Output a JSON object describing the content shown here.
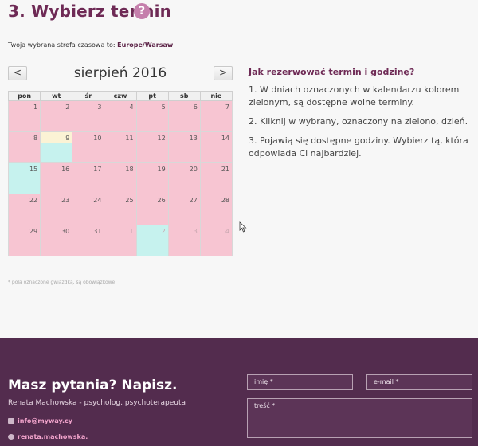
{
  "header": {
    "title": "3. Wybierz termin",
    "help_icon": "?"
  },
  "timezone": {
    "prefix": "Twoja wybrana strefa czasowa to:",
    "value": "Europe/Warsaw"
  },
  "calendar": {
    "prev_label": "<",
    "next_label": ">",
    "month_title": "sierpień 2016",
    "weekdays": [
      "pon",
      "wt",
      "śr",
      "czw",
      "pt",
      "sb",
      "nie"
    ],
    "weeks": [
      [
        {
          "d": "1"
        },
        {
          "d": "2"
        },
        {
          "d": "3"
        },
        {
          "d": "4"
        },
        {
          "d": "5"
        },
        {
          "d": "6"
        },
        {
          "d": "7"
        }
      ],
      [
        {
          "d": "8"
        },
        {
          "d": "9",
          "state": "today"
        },
        {
          "d": "10"
        },
        {
          "d": "11"
        },
        {
          "d": "12"
        },
        {
          "d": "13"
        },
        {
          "d": "14"
        }
      ],
      [
        {
          "d": "15",
          "state": "green"
        },
        {
          "d": "16"
        },
        {
          "d": "17"
        },
        {
          "d": "18"
        },
        {
          "d": "19"
        },
        {
          "d": "20"
        },
        {
          "d": "21"
        }
      ],
      [
        {
          "d": "22"
        },
        {
          "d": "23"
        },
        {
          "d": "24"
        },
        {
          "d": "25"
        },
        {
          "d": "26"
        },
        {
          "d": "27"
        },
        {
          "d": "28"
        }
      ],
      [
        {
          "d": "29"
        },
        {
          "d": "30"
        },
        {
          "d": "31"
        },
        {
          "d": "1",
          "state": "other"
        },
        {
          "d": "2",
          "state": "other-green"
        },
        {
          "d": "3",
          "state": "other"
        },
        {
          "d": "4",
          "state": "other"
        }
      ]
    ]
  },
  "instructions": {
    "title": "Jak rezerwować termin i godzinę?",
    "steps": [
      "1. W dniach oznaczonych w kalendarzu kolorem zielonym, są dostępne wolne terminy.",
      "2. Kliknij w wybrany, oznaczony na zielono, dzień.",
      "3. Pojawią się dostępne godziny. Wybierz tą, która odpowiada Ci najbardziej."
    ]
  },
  "required_note": "* pola oznaczone gwiazdką, są obowiązkowe",
  "footer": {
    "title": "Masz pytania? Napisz.",
    "subtitle": "Renata Machowska - psycholog, psychoterapeuta",
    "email": "info@myway.cy",
    "skype": "renata.machowska.",
    "name_placeholder": "imię *",
    "email_placeholder": "e-mail *",
    "message_placeholder": "treść *"
  },
  "colors": {
    "accent": "#6e2a55",
    "available": "#c6f2ee",
    "unavailable": "#f7c5d2",
    "today": "#fbf3d5",
    "footer_bg": "#532c4e"
  }
}
